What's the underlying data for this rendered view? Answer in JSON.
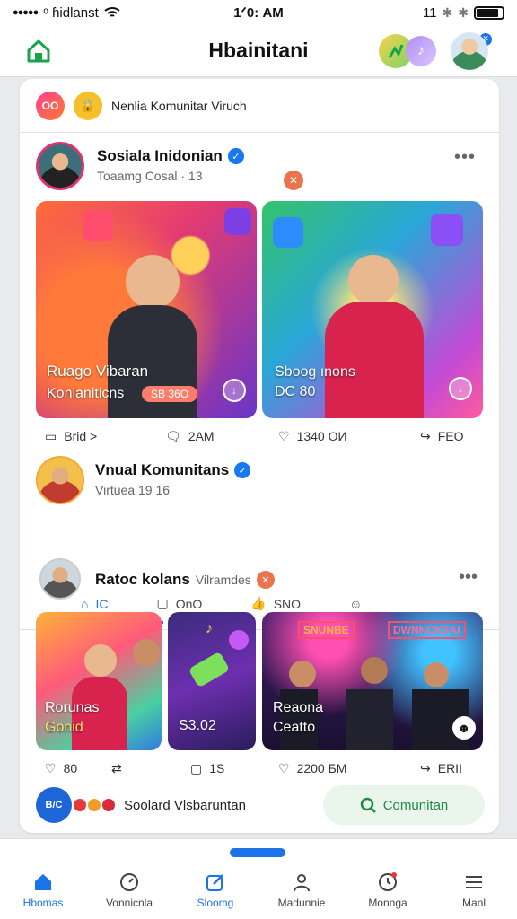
{
  "status": {
    "carrier": "ᵒ ɦidlanst",
    "time": "1ᐟ0: AM",
    "right_text": "11"
  },
  "header": {
    "title": "Hbainitani"
  },
  "top_pill": {
    "label": "Nenlia Komunitar Viruch"
  },
  "post1": {
    "author": "Sosiala Inidonian",
    "meta": "Toaamg Cosal · 13",
    "left_caption_1": "Ruago Vibaran",
    "left_caption_2": "Konlaniticns",
    "left_badge": "SB 36O",
    "right_caption_1": "Sboog ınons",
    "right_caption_2": "DC 80",
    "action_1": "Brid >",
    "action_2": "2AM",
    "action_3": "1340 ОИ",
    "action_4": "FEO"
  },
  "post2": {
    "author": "Vnual Komunitans",
    "meta": "Virtuea 19 16",
    "tab_1": "IC",
    "tab_2": "OnO",
    "tab_3": "SNO"
  },
  "post3": {
    "author": "Ratoc kolans",
    "author_extra": "Vilramdes",
    "img1_caption_1": "Rorunas",
    "img1_caption_2": "Gonid",
    "img2_caption": "S3.02",
    "img3_caption_1": "Reaona",
    "img3_caption_2": "Ceatto",
    "img3_sign_1": "SNUNBE",
    "img3_sign_2": "DWNNCKSAI",
    "action_1": "80",
    "action_2": "1S",
    "action_3": "2200 БМ",
    "action_4": "ERII"
  },
  "footer_row": {
    "label": "Soolard Vlsbaruntan",
    "button": "Comunitan"
  },
  "nav": [
    {
      "label": "Hbomas"
    },
    {
      "label": "Vonnicnla"
    },
    {
      "label": "Sloomg"
    },
    {
      "label": "Madunnie"
    },
    {
      "label": "Monnga"
    },
    {
      "label": "Manl"
    }
  ],
  "colors": {
    "accent": "#1a73e8",
    "green": "#27a55a",
    "verify": "#1877f2"
  }
}
